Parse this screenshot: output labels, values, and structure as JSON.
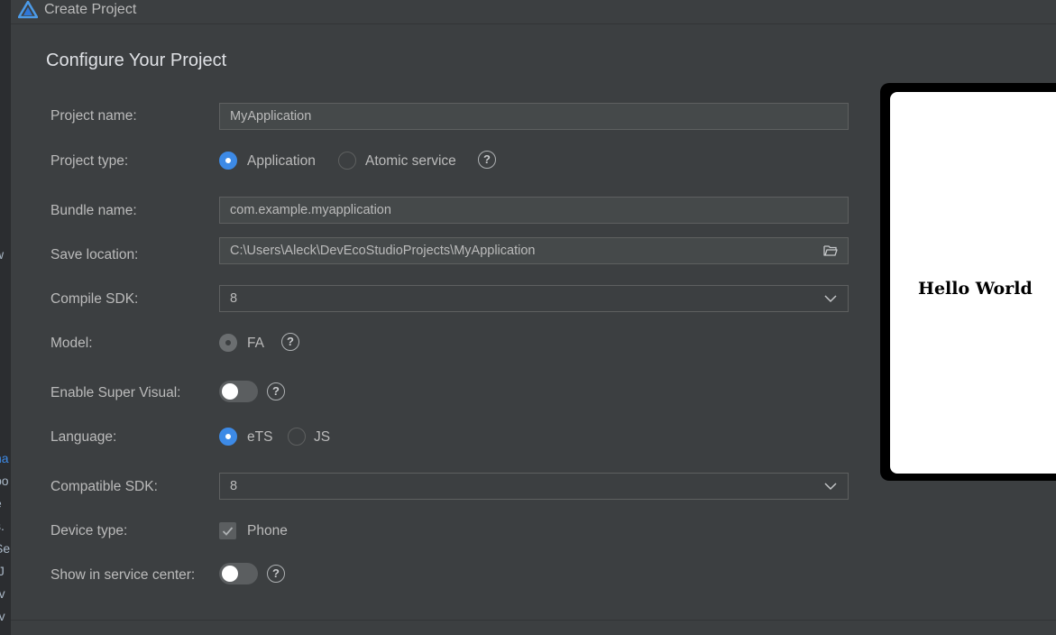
{
  "window": {
    "title": "Create Project"
  },
  "page": {
    "title": "Configure Your Project"
  },
  "background_fragments": [
    "w",
    "na",
    "po",
    "e",
    "s.",
    "Se",
    "tJ",
    "rv",
    "rv"
  ],
  "form": {
    "project_name": {
      "label": "Project name:",
      "value": "MyApplication"
    },
    "project_type": {
      "label": "Project type:",
      "options": [
        "Application",
        "Atomic service"
      ],
      "selected": "Application"
    },
    "bundle_name": {
      "label": "Bundle name:",
      "value": "com.example.myapplication"
    },
    "save_location": {
      "label": "Save location:",
      "value": "C:\\Users\\Aleck\\DevEcoStudioProjects\\MyApplication"
    },
    "compile_sdk": {
      "label": "Compile SDK:",
      "value": "8"
    },
    "model": {
      "label": "Model:",
      "options": [
        "FA"
      ],
      "selected": "FA"
    },
    "enable_super_visual": {
      "label": "Enable Super Visual:",
      "on": false
    },
    "language": {
      "label": "Language:",
      "options": [
        "eTS",
        "JS"
      ],
      "selected": "eTS"
    },
    "compatible_sdk": {
      "label": "Compatible SDK:",
      "value": "8"
    },
    "device_type": {
      "label": "Device type:",
      "options": [
        "Phone"
      ],
      "checked": [
        "Phone"
      ]
    },
    "show_in_service_center": {
      "label": "Show in service center:",
      "on": false
    }
  },
  "help_glyph": "?",
  "preview": {
    "text": "Hello World"
  },
  "colors": {
    "accent": "#3d8ae6",
    "background": "#3c3f41",
    "field_bg": "#45494a"
  }
}
